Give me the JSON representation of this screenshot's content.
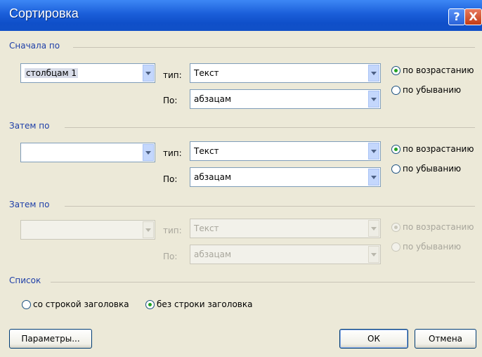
{
  "window": {
    "title": "Сортировка",
    "help_glyph": "?",
    "close_glyph": "X"
  },
  "sort1": {
    "section_label": "Сначала по",
    "field_value": "столбцам 1",
    "type_label": "тип:",
    "type_value": "Текст",
    "by_label": "По:",
    "by_value": "абзацам",
    "asc_label": "по возрастанию",
    "desc_label": "по убыванию",
    "selected_order": "asc"
  },
  "sort2": {
    "section_label": "Затем по",
    "field_value": "",
    "type_label": "тип:",
    "type_value": "Текст",
    "by_label": "По:",
    "by_value": "абзацам",
    "asc_label": "по возрастанию",
    "desc_label": "по убыванию",
    "selected_order": "asc"
  },
  "sort3": {
    "section_label": "Затем по",
    "field_value": "",
    "type_label": "тип:",
    "type_value": "Текст",
    "by_label": "По:",
    "by_value": "абзацам",
    "asc_label": "по возрастанию",
    "desc_label": "по убыванию",
    "selected_order": "asc",
    "disabled": true
  },
  "list": {
    "section_label": "Список",
    "with_header_label": "со строкой заголовка",
    "without_header_label": "без строки заголовка",
    "selected": "without_header"
  },
  "buttons": {
    "options_label": "Параметры...",
    "ok_label": "ОК",
    "cancel_label": "Отмена"
  },
  "colors": {
    "titlebar": "#0f4fc9",
    "section_label": "#1e3fa8",
    "radio_dot": "#21a121",
    "dialog_bg": "#ece9d8"
  }
}
